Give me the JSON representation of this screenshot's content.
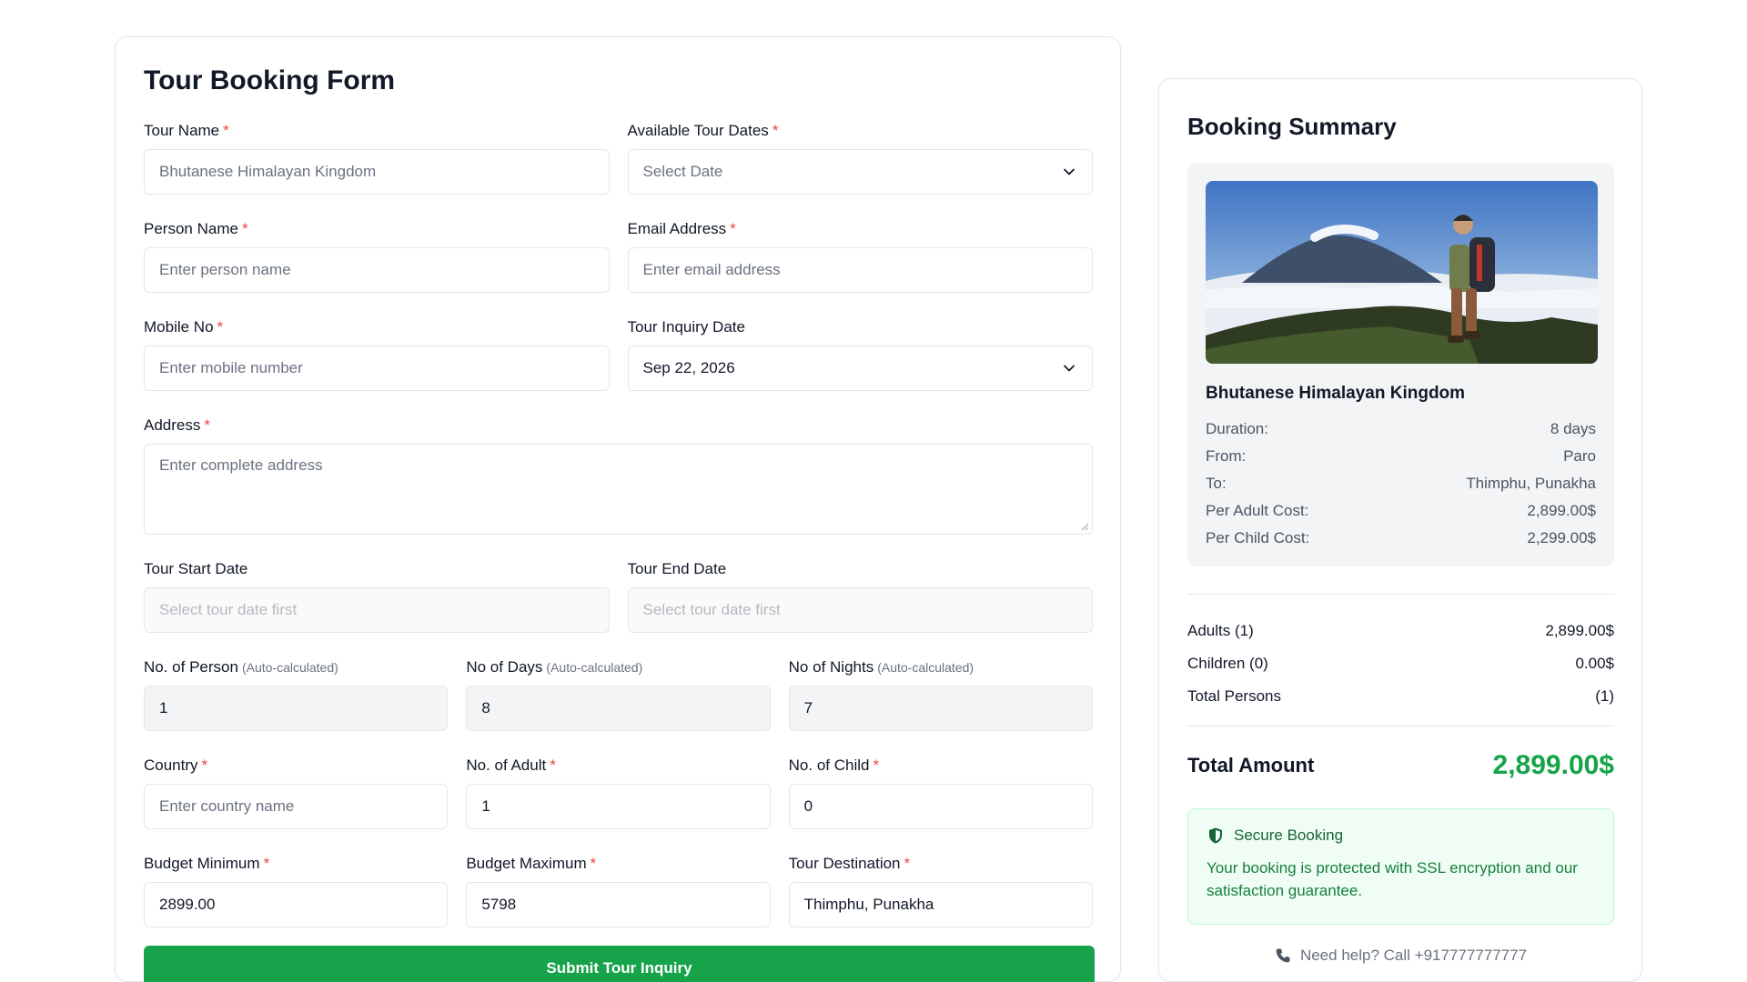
{
  "form": {
    "title": "Tour Booking Form",
    "tour_name": {
      "label": "Tour Name",
      "placeholder": "Bhutanese Himalayan Kingdom"
    },
    "tour_dates": {
      "label": "Available Tour Dates",
      "value": "Select Date"
    },
    "person_name": {
      "label": "Person Name",
      "placeholder": "Enter person name"
    },
    "email": {
      "label": "Email Address",
      "placeholder": "Enter email address"
    },
    "mobile": {
      "label": "Mobile No",
      "placeholder": "Enter mobile number"
    },
    "inquiry_date": {
      "label": "Tour Inquiry Date",
      "value": "Sep 22, 2026"
    },
    "address": {
      "label": "Address",
      "placeholder": "Enter complete address"
    },
    "start_date": {
      "label": "Tour Start Date",
      "placeholder": "Select tour date first"
    },
    "end_date": {
      "label": "Tour End Date",
      "placeholder": "Select tour date first"
    },
    "num_person": {
      "label": "No. of Person",
      "note": "(Auto-calculated)",
      "value": "1"
    },
    "num_days": {
      "label": "No of Days",
      "note": "(Auto-calculated)",
      "value": "8"
    },
    "num_nights": {
      "label": "No of Nights",
      "note": "(Auto-calculated)",
      "value": "7"
    },
    "country": {
      "label": "Country",
      "placeholder": "Enter country name"
    },
    "num_adult": {
      "label": "No. of Adult",
      "value": "1"
    },
    "num_child": {
      "label": "No. of Child",
      "value": "0"
    },
    "budget_min": {
      "label": "Budget Minimum",
      "value": "2899.00"
    },
    "budget_max": {
      "label": "Budget Maximum",
      "value": "5798"
    },
    "destination": {
      "label": "Tour Destination",
      "value": "Thimphu, Punakha"
    },
    "required_mark": "*",
    "submit_label": "Submit Tour Inquiry"
  },
  "summary": {
    "title": "Booking Summary",
    "tour_name": "Bhutanese Himalayan Kingdom",
    "details": [
      {
        "key": "Duration:",
        "value": "8 days"
      },
      {
        "key": "From:",
        "value": "Paro"
      },
      {
        "key": "To:",
        "value": "Thimphu, Punakha"
      },
      {
        "key": "Per Adult Cost:",
        "value": "2,899.00$"
      },
      {
        "key": "Per Child Cost:",
        "value": "2,299.00$"
      }
    ],
    "totals": [
      {
        "key": "Adults (1)",
        "value": "2,899.00$"
      },
      {
        "key": "Children (0)",
        "value": "0.00$"
      },
      {
        "key": "Total Persons",
        "value": "(1)"
      }
    ],
    "total_label": "Total Amount",
    "total_value": "2,899.00$",
    "secure_title": "Secure Booking",
    "secure_text": "Your booking is protected with SSL encryption and our satisfaction guarantee.",
    "help_text": "Need help? Call +917777777777"
  },
  "colors": {
    "accent_green": "#16a34a",
    "required_red": "#ef4444",
    "secure_bg": "#f0fdf4"
  },
  "icons": {
    "select_chevron": "chevron-down-icon",
    "secure": "shield-icon",
    "help": "phone-icon"
  }
}
